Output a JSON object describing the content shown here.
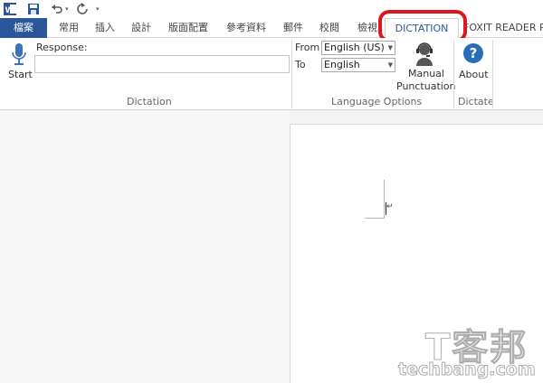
{
  "quick_access": {
    "app_icon": "word-icon",
    "save_icon": "save-icon",
    "undo_icon": "undo-icon",
    "redo_icon": "redo-icon",
    "customize_icon": "chevron-down-icon"
  },
  "tabs": [
    {
      "label": "檔案"
    },
    {
      "label": "常用"
    },
    {
      "label": "插入"
    },
    {
      "label": "設計"
    },
    {
      "label": "版面配置"
    },
    {
      "label": "參考資料"
    },
    {
      "label": "郵件"
    },
    {
      "label": "校閱"
    },
    {
      "label": "檢視"
    },
    {
      "label": "DICTATION"
    },
    {
      "label": "FOXIT READER PDF"
    }
  ],
  "dictation_group": {
    "start_label": "Start",
    "response_label": "Response:",
    "response_value": "",
    "group_label": "Dictation",
    "mic_icon": "microphone-icon"
  },
  "language_group": {
    "from_label": "From",
    "from_value": "English (US)",
    "to_label": "To",
    "to_value": "English",
    "manual_label_line1": "Manual",
    "manual_label_line2": "Punctuation",
    "manual_icon": "headset-person-icon",
    "group_label": "Language Options"
  },
  "dictate_group": {
    "about_label": "About",
    "about_icon": "help-circle-icon",
    "group_label": "Dictate"
  },
  "document": {
    "paragraph_mark": "↵"
  },
  "watermark": {
    "text_top": "T客邦",
    "text_bottom": "techbang.com"
  }
}
